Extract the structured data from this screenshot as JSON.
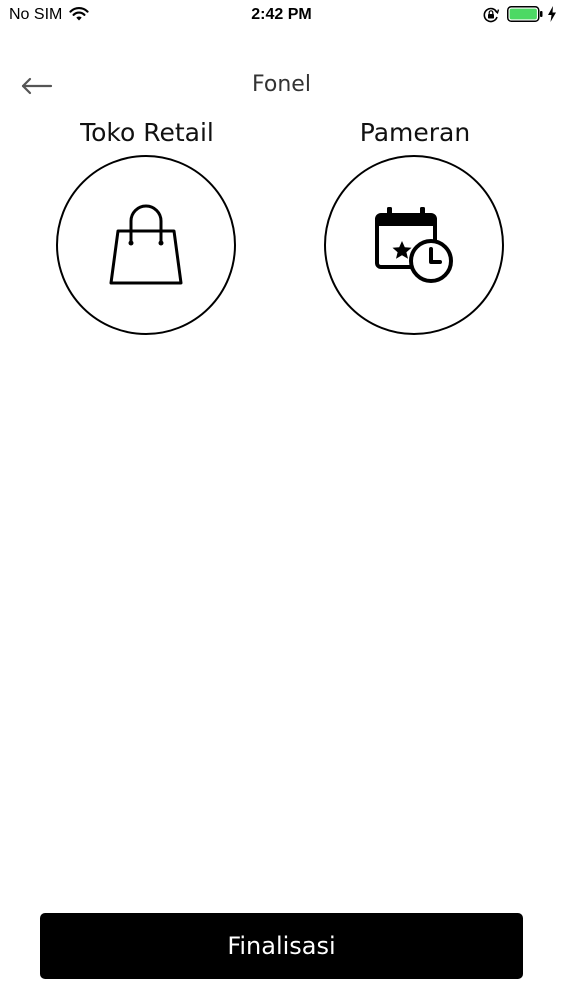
{
  "status_bar": {
    "carrier": "No SIM",
    "time": "2:42 PM",
    "battery_color": "#4cd964",
    "icons": [
      "wifi-icon",
      "rotation-lock-icon",
      "battery-icon",
      "charging-icon"
    ]
  },
  "header": {
    "title": "Fonel",
    "back_icon": "arrow-left-icon"
  },
  "options": [
    {
      "label": "Toko Retail",
      "icon": "shopping-bag-icon"
    },
    {
      "label": "Pameran",
      "icon": "calendar-clock-icon"
    }
  ],
  "footer": {
    "finalize_label": "Finalisasi",
    "button_color": "#000000"
  }
}
